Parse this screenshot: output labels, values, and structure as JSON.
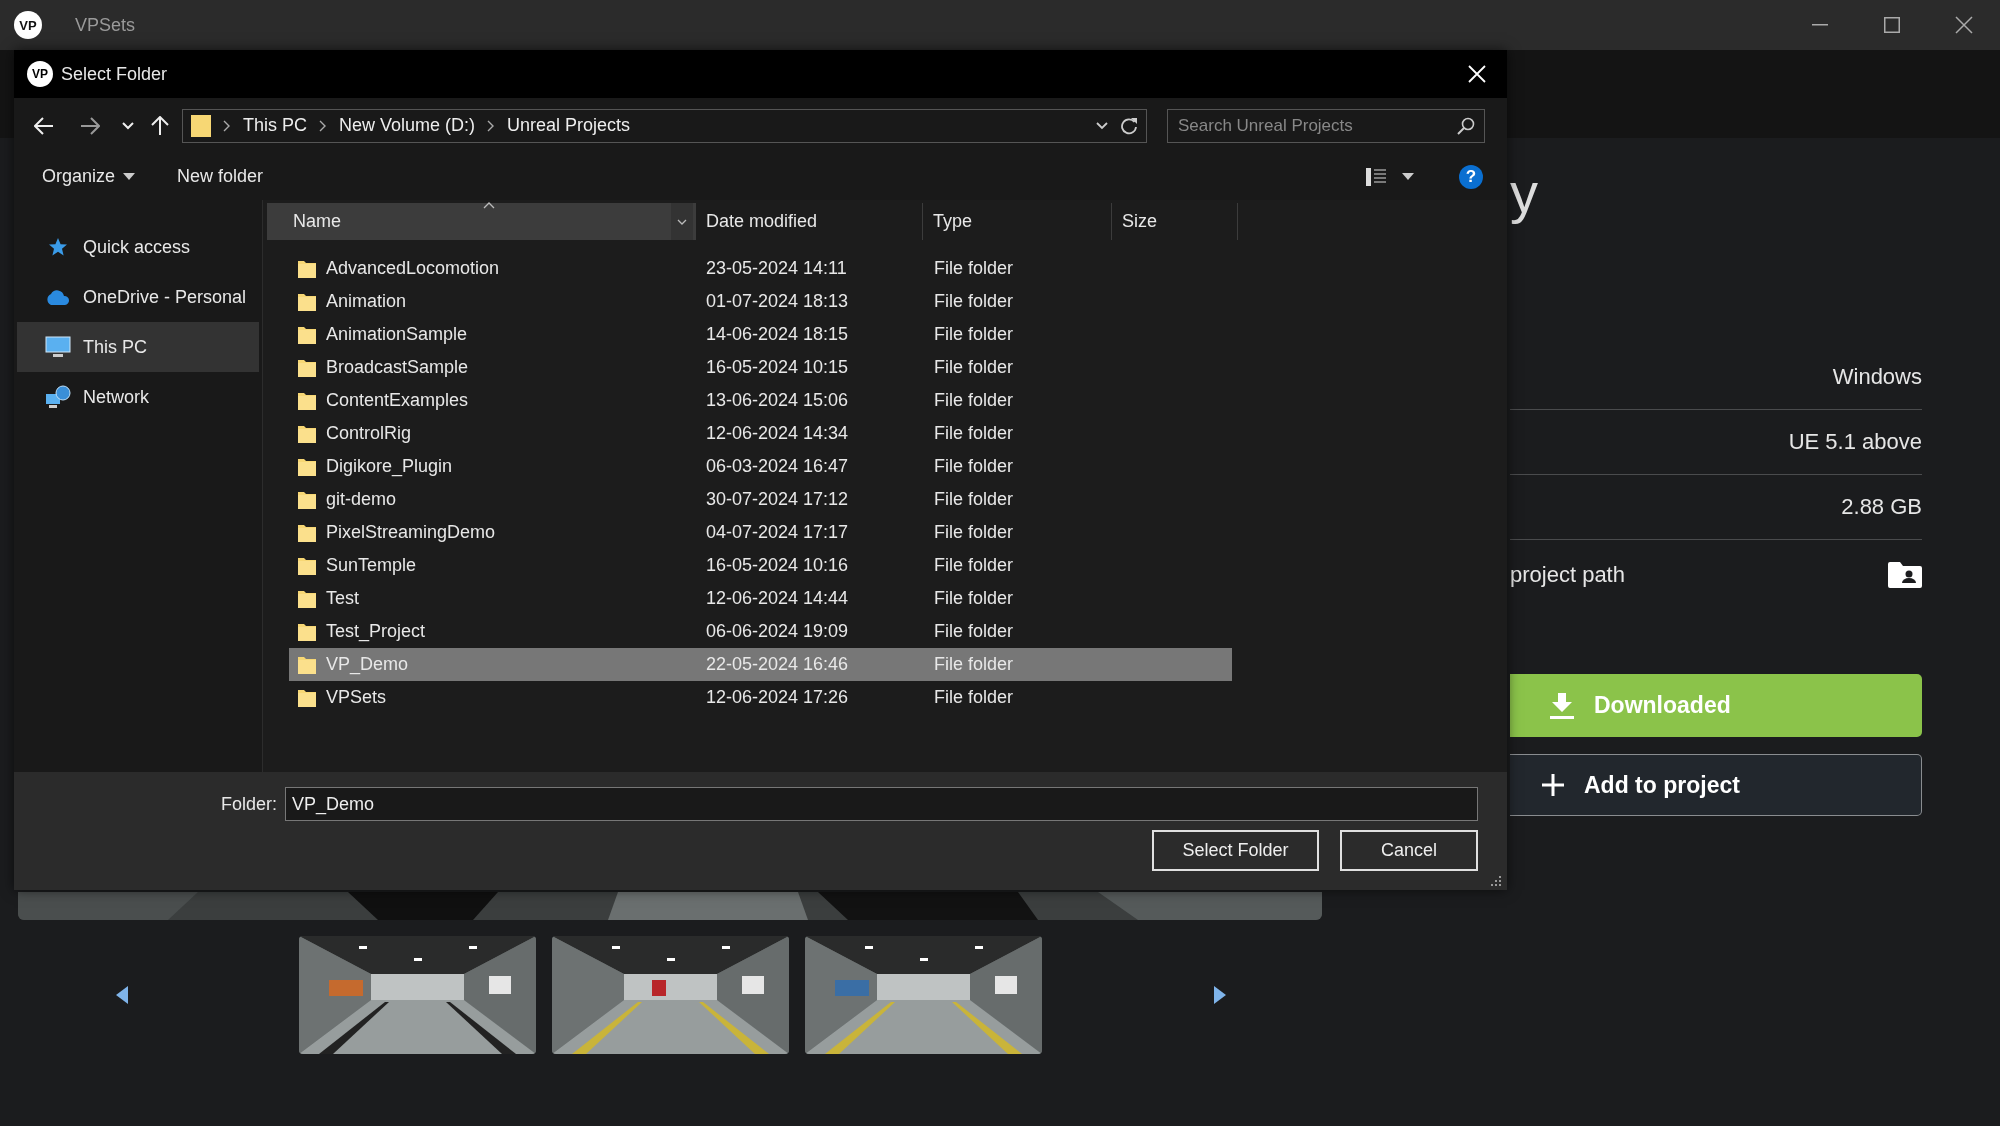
{
  "app": {
    "logo": "VP",
    "title": "VPSets"
  },
  "details": {
    "heading": "y",
    "rows": [
      "Windows",
      "UE 5.1 above",
      "2.88 GB"
    ],
    "path_label": "project path",
    "buttons": [
      {
        "kind": "primary",
        "label": "Downloaded"
      },
      {
        "kind": "secondary",
        "label": "Add to project"
      }
    ]
  },
  "dialog": {
    "logo": "VP",
    "title": "Select Folder",
    "breadcrumb": [
      "This PC",
      "New Volume (D:)",
      "Unreal Projects"
    ],
    "search": {
      "placeholder": "Search Unreal Projects"
    },
    "toolbar": {
      "organize": "Organize",
      "new_folder": "New folder",
      "help": "?"
    },
    "nav": [
      {
        "kind": "star",
        "label": "Quick access",
        "selected": false
      },
      {
        "kind": "cloud",
        "label": "OneDrive - Personal",
        "selected": false
      },
      {
        "kind": "pc",
        "label": "This PC",
        "selected": true
      },
      {
        "kind": "network",
        "label": "Network",
        "selected": false
      }
    ],
    "columns": [
      "Name",
      "Date modified",
      "Type",
      "Size"
    ],
    "rows": [
      {
        "name": "AdvancedLocomotion",
        "date": "23-05-2024 14:11",
        "type": "File folder",
        "selected": false
      },
      {
        "name": "Animation",
        "date": "01-07-2024 18:13",
        "type": "File folder",
        "selected": false
      },
      {
        "name": "AnimationSample",
        "date": "14-06-2024 18:15",
        "type": "File folder",
        "selected": false
      },
      {
        "name": "BroadcastSample",
        "date": "16-05-2024 10:15",
        "type": "File folder",
        "selected": false
      },
      {
        "name": "ContentExamples",
        "date": "13-06-2024 15:06",
        "type": "File folder",
        "selected": false
      },
      {
        "name": "ControlRig",
        "date": "12-06-2024 14:34",
        "type": "File folder",
        "selected": false
      },
      {
        "name": "Digikore_Plugin",
        "date": "06-03-2024 16:47",
        "type": "File folder",
        "selected": false
      },
      {
        "name": "git-demo",
        "date": "30-07-2024 17:12",
        "type": "File folder",
        "selected": false
      },
      {
        "name": "PixelStreamingDemo",
        "date": "04-07-2024 17:17",
        "type": "File folder",
        "selected": false
      },
      {
        "name": "SunTemple",
        "date": "16-05-2024 10:16",
        "type": "File folder",
        "selected": false
      },
      {
        "name": "Test",
        "date": "12-06-2024 14:44",
        "type": "File folder",
        "selected": false
      },
      {
        "name": "Test_Project",
        "date": "06-06-2024 19:09",
        "type": "File folder",
        "selected": false
      },
      {
        "name": "VP_Demo",
        "date": "22-05-2024 16:46",
        "type": "File folder",
        "selected": true
      },
      {
        "name": "VPSets",
        "date": "12-06-2024 17:26",
        "type": "File folder",
        "selected": false
      }
    ],
    "folder": {
      "label": "Folder:",
      "value": "VP_Demo"
    },
    "buttons": [
      "Select Folder",
      "Cancel"
    ]
  }
}
